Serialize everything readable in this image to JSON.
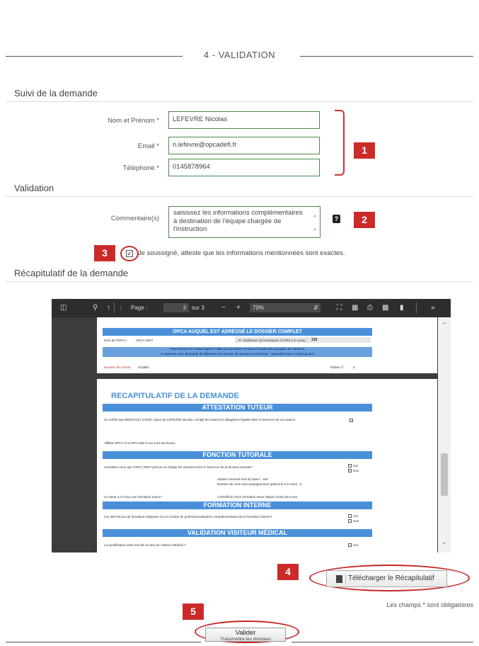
{
  "section": {
    "title": "4 - VALIDATION"
  },
  "suivi": {
    "title": "Suivi de la demande",
    "fields": [
      {
        "label": "Nom et Prénom *",
        "value": "LEFEVRE Nicolas"
      },
      {
        "label": "Email *",
        "value": "n.lefevre@opcadefi.fr"
      },
      {
        "label": "Téléphone *",
        "value": "0145878964"
      }
    ]
  },
  "validation": {
    "title": "Validation",
    "comment_label": "Commentaire(s)",
    "comment_value": "saisissez les informations complémentaires à destination de l'équipe chargée de l'instruction",
    "help_icon": "?",
    "attest_text": "Je soussigné, atteste que les informations mentionnées sont exactes.",
    "attest_checked": true
  },
  "recap": {
    "title": "Récapitulatif de la demande"
  },
  "viewer": {
    "toolbar": {
      "page_label": "Page :",
      "page_value": "3",
      "page_total": "sur 3",
      "zoom": "70%"
    },
    "pdf": {
      "header_bar": "OPCA AUQUEL EST ADRESSÉ LE DOSSIER COMPLET",
      "opca_label": "Nom de l'OPCA :",
      "opca_value": "OPCA DEFI",
      "adhesion_label": "N° d'adhésion de l'entreprise à l'OPCA si connu :",
      "adhesion_value": "159",
      "info_line1": "Pour envoyer le contrat signé et daté au à la notice ne sauront fondé des ouvrages de l'article 5",
      "info_line2": "ou adresse votre demande de dépense et le dossier de secours au l'intérieur : www.alternance.emploi.gouv.fr",
      "contract_label": "Numéro de contrat :",
      "contract_value": "012856",
      "edition_label": "Édition n°:",
      "edition_value": "2",
      "page_title": "RECAPITULATIF DE LA DEMANDE",
      "bars": [
        "ATTESTATION TUTEUR",
        "FONCTION TUTORALE",
        "FORMATION INTERNE",
        "VALIDATION VISITEUR MÉDICAL"
      ],
      "line_tuteur": "Je certifie que BERNAULT DAVID, tuteur de LEFEVRE Nicolas, remplit les toutes les obligations légales liées à l'exercice de sa mission.",
      "line_affiliation": "Affiliée OPCA-Vi à OPCADE-VI au zone du Rouen",
      "line_fonction": "Souhaitez-vous que l'OPCA DEFI prenne en charge les missions liées à l'exercice de la fonction tutorale?",
      "line_salaire1": "Salaire mensuel brut du tuteur : 160",
      "line_salaire2": "Nombre de mois d'accompagnement (plafonné à 6 mois) : 6",
      "line_formation_tuteur": "Le tuteur a-t-il reçu une formation tuteur?",
      "line_formation_resp": "A bénéficié d'une formation tuteur depuis moins de 5 ans",
      "line_interne": "Les 400 heures de formation indiquées sur le Contrat de professionnalisation complémentaires de la formation interne?",
      "line_visiteur": "La qualification visée est-elle un titre de Visiteur Médical ?",
      "oui": "Oui",
      "non": "Non"
    }
  },
  "download_label": "Télécharger le Récapitulatif",
  "required_note": "Les champs * sont obligatoires",
  "submit": {
    "label": "Valider",
    "sub": "Transmettre les données"
  },
  "callouts": [
    "1",
    "2",
    "3",
    "4",
    "5"
  ]
}
